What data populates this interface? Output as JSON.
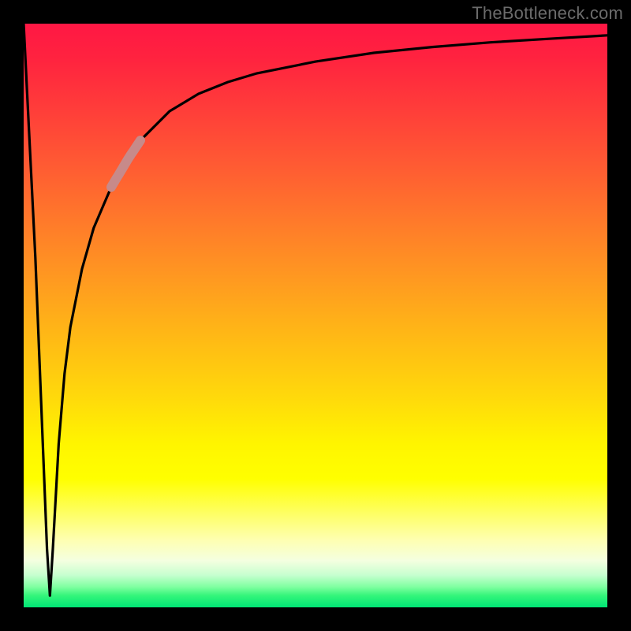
{
  "attribution": "TheBottleneck.com",
  "colors": {
    "frame": "#000000",
    "curve": "#000000",
    "highlight": "#c78a8a",
    "gradient_top": "#ff1744",
    "gradient_mid": "#ffff00",
    "gradient_bottom": "#00e676"
  },
  "chart_data": {
    "type": "line",
    "title": "",
    "xlabel": "",
    "ylabel": "",
    "xlim": [
      0,
      100
    ],
    "ylim": [
      0,
      100
    ],
    "grid": false,
    "legend": false,
    "series": [
      {
        "name": "curve",
        "x": [
          0,
          2,
          4,
          4.5,
          5,
          6,
          7,
          8,
          10,
          12,
          15,
          18,
          20,
          25,
          30,
          35,
          40,
          50,
          60,
          70,
          80,
          90,
          100
        ],
        "values": [
          100,
          60,
          10,
          2,
          10,
          28,
          40,
          48,
          58,
          65,
          72,
          77,
          80,
          85,
          88,
          90,
          91.5,
          93.5,
          95,
          96,
          96.8,
          97.4,
          98
        ]
      }
    ],
    "highlight_segment": {
      "series": "curve",
      "x_start": 15,
      "x_end": 20
    }
  }
}
